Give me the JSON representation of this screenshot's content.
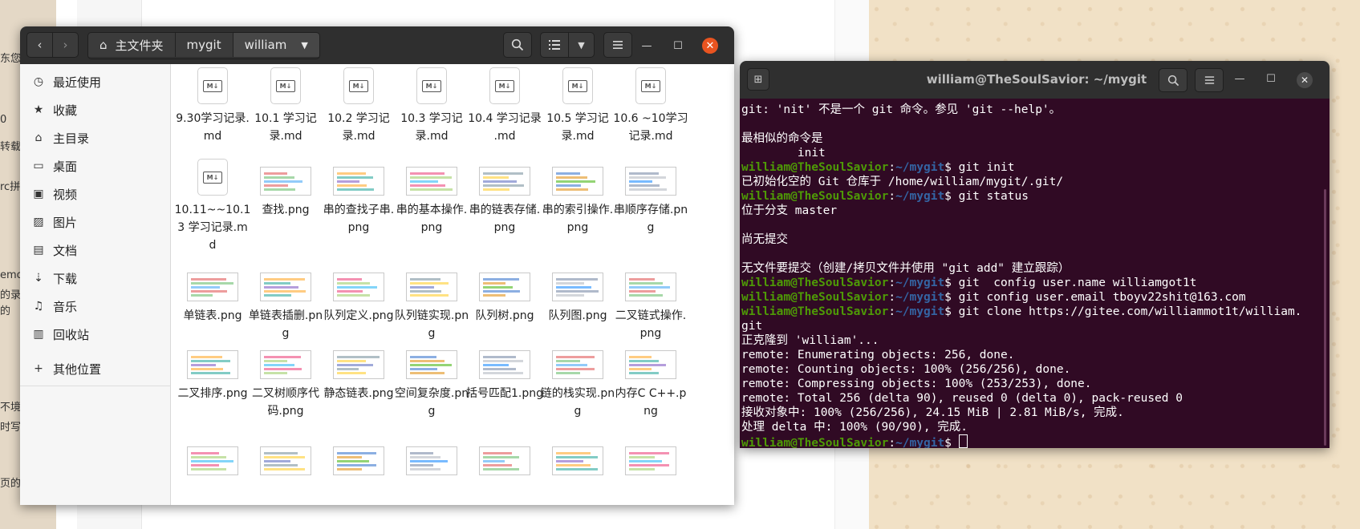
{
  "background": {
    "left_fragments": [
      "东您",
      "0",
      "转载",
      "rc拼",
      "emo",
      "的录",
      "的",
      "不境变",
      "时写",
      "页的页"
    ]
  },
  "file_manager": {
    "nav": {
      "back": "‹",
      "forward": "›"
    },
    "breadcrumbs": [
      "主文件夹",
      "mygit",
      "william"
    ],
    "sidebar": [
      {
        "label": "最近使用",
        "icon": "clock-icon"
      },
      {
        "label": "收藏",
        "icon": "star-icon"
      },
      {
        "label": "主目录",
        "icon": "home-icon"
      },
      {
        "label": "桌面",
        "icon": "desktop-icon"
      },
      {
        "label": "视频",
        "icon": "video-icon"
      },
      {
        "label": "图片",
        "icon": "image-icon"
      },
      {
        "label": "文档",
        "icon": "document-icon"
      },
      {
        "label": "下载",
        "icon": "download-icon"
      },
      {
        "label": "音乐",
        "icon": "music-icon"
      },
      {
        "label": "回收站",
        "icon": "trash-icon"
      },
      {
        "label": "其他位置",
        "icon": "plus-icon"
      }
    ],
    "files": [
      {
        "name": "9.30学习记录.md",
        "type": "md"
      },
      {
        "name": "10.1 学习记录.md",
        "type": "md"
      },
      {
        "name": "10.2 学习记录.md",
        "type": "md"
      },
      {
        "name": "10.3 学习记录.md",
        "type": "md"
      },
      {
        "name": "10.4 学习记录 .md",
        "type": "md"
      },
      {
        "name": "10.5 学习记录.md",
        "type": "md"
      },
      {
        "name": "10.6 ~10学习记录.md",
        "type": "md"
      },
      {
        "name": "10.11~~10.13 学习记录.md",
        "type": "md"
      },
      {
        "name": "查找.png",
        "type": "png"
      },
      {
        "name": "串的查找子串.png",
        "type": "png"
      },
      {
        "name": "串的基本操作.png",
        "type": "png"
      },
      {
        "name": "串的链表存储.png",
        "type": "png"
      },
      {
        "name": "串的索引操作.png",
        "type": "png"
      },
      {
        "name": "串顺序存储.png",
        "type": "png"
      },
      {
        "name": "单链表.png",
        "type": "png"
      },
      {
        "name": "单链表插删.png",
        "type": "png"
      },
      {
        "name": "队列定义.png",
        "type": "png"
      },
      {
        "name": "队列链实现.png",
        "type": "png"
      },
      {
        "name": "队列树.png",
        "type": "png"
      },
      {
        "name": "队列图.png",
        "type": "png"
      },
      {
        "name": "二叉链式操作.png",
        "type": "png"
      },
      {
        "name": "二叉排序.png",
        "type": "png"
      },
      {
        "name": "二叉树顺序代码.png",
        "type": "png"
      },
      {
        "name": "静态链表.png",
        "type": "png"
      },
      {
        "name": "空间复杂度.png",
        "type": "png"
      },
      {
        "name": "括号匹配1.png",
        "type": "png"
      },
      {
        "name": "链的栈实现.png",
        "type": "png"
      },
      {
        "name": "内存C C++.png",
        "type": "png"
      },
      {
        "name": "",
        "type": "png"
      },
      {
        "name": "",
        "type": "png"
      },
      {
        "name": "",
        "type": "png"
      },
      {
        "name": "",
        "type": "png"
      },
      {
        "name": "",
        "type": "png"
      },
      {
        "name": "",
        "type": "png"
      },
      {
        "name": "",
        "type": "png"
      }
    ]
  },
  "terminal": {
    "title": "william@TheSoulSavior: ~/mygit",
    "user_host": "william@TheSoulSavior",
    "path": "~/mygit",
    "lines": [
      {
        "t": "out",
        "text": "git: 'nit' 不是一个 git 命令。参见 'git --help'。"
      },
      {
        "t": "out",
        "text": ""
      },
      {
        "t": "out",
        "text": "最相似的命令是"
      },
      {
        "t": "out",
        "text": "        init"
      },
      {
        "t": "cmd",
        "text": "git init"
      },
      {
        "t": "out",
        "text": "已初始化空的 Git 仓库于 /home/william/mygit/.git/"
      },
      {
        "t": "cmd",
        "text": "git status"
      },
      {
        "t": "out",
        "text": "位于分支 master"
      },
      {
        "t": "out",
        "text": ""
      },
      {
        "t": "out",
        "text": "尚无提交"
      },
      {
        "t": "out",
        "text": ""
      },
      {
        "t": "out",
        "text": "无文件要提交（创建/拷贝文件并使用 \"git add\" 建立跟踪）"
      },
      {
        "t": "cmd",
        "text": "git  config user.name williamgot1t"
      },
      {
        "t": "cmd",
        "text": "git config user.email tboyv22shit@163.com"
      },
      {
        "t": "cmd",
        "text": "git clone https://gitee.com/williammot1t/william."
      },
      {
        "t": "out",
        "text": "git"
      },
      {
        "t": "out",
        "text": "正克隆到 'william'..."
      },
      {
        "t": "out",
        "text": "remote: Enumerating objects: 256, done."
      },
      {
        "t": "out",
        "text": "remote: Counting objects: 100% (256/256), done."
      },
      {
        "t": "out",
        "text": "remote: Compressing objects: 100% (253/253), done."
      },
      {
        "t": "out",
        "text": "remote: Total 256 (delta 90), reused 0 (delta 0), pack-reused 0"
      },
      {
        "t": "out",
        "text": "接收对象中: 100% (256/256), 24.15 MiB | 2.81 MiB/s, 完成."
      },
      {
        "t": "out",
        "text": "处理 delta 中: 100% (90/90), 完成."
      },
      {
        "t": "prompt",
        "text": ""
      }
    ]
  }
}
